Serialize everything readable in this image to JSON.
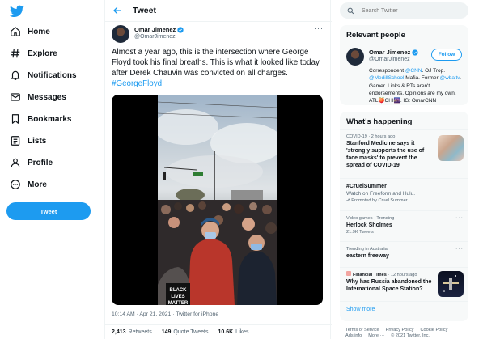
{
  "colors": {
    "accent": "#1d9bf0",
    "text": "#0f1419",
    "muted": "#536471"
  },
  "nav": {
    "logo_icon": "twitter-bird-icon",
    "items": [
      {
        "label": "Home",
        "icon": "home-icon"
      },
      {
        "label": "Explore",
        "icon": "hashtag-icon"
      },
      {
        "label": "Notifications",
        "icon": "bell-icon"
      },
      {
        "label": "Messages",
        "icon": "envelope-icon"
      },
      {
        "label": "Bookmarks",
        "icon": "bookmark-icon"
      },
      {
        "label": "Lists",
        "icon": "list-icon"
      },
      {
        "label": "Profile",
        "icon": "person-icon"
      },
      {
        "label": "More",
        "icon": "more-circle-icon"
      }
    ],
    "tweet_button": "Tweet"
  },
  "header": {
    "title": "Tweet"
  },
  "tweet": {
    "author_name": "Omar Jimenez",
    "author_handle": "@OmarJimenez",
    "text": "Almost a year ago, this is the intersection where George Floyd took his final breaths. This is what it looked like today after Derek Chauvin was convicted on all charges. ",
    "hashtag": "#GeorgeFloyd",
    "timestamp": "10:14 AM · Apr 21, 2021 · Twitter for iPhone",
    "retweets": "2,413",
    "retweets_label": "Retweets",
    "quote_tweets": "149",
    "quote_tweets_label": "Quote Tweets",
    "likes": "10.6K",
    "likes_label": "Likes",
    "media_sign": "BLACK LIVES MATTER"
  },
  "search": {
    "placeholder": "Search Twitter"
  },
  "relevant": {
    "title": "Relevant people",
    "name": "Omar Jimenez",
    "handle": "@OmarJimenez",
    "follow_label": "Follow",
    "bio_1": "Correspondent ",
    "bio_cnn": "@CNN",
    "bio_2": ". OJ Trop. ",
    "bio_medill": "@MedillSchool",
    "bio_3": " Mafia. Former ",
    "bio_wbal": "@wbaltv",
    "bio_4": ". Gamer. Links & RTs aren't endorsements. Opinions are my own. ATL🍑CHI🌆. IG: OmarCNN"
  },
  "happening": {
    "title": "What's happening",
    "trends": [
      {
        "meta": "COVID-19 · 2 hours ago",
        "head": "Stanford Medicine says it 'strongly supports the use of face masks' to prevent the spread of COVID-19"
      },
      {
        "meta": "",
        "head": "#CruelSummer",
        "sub": "Watch on Freeform and Hulu.",
        "promo": "Promoted by Cruel Summer"
      },
      {
        "meta": "Video games · Trending",
        "head": "Herlock Sholmes",
        "sub": "21.9K Tweets"
      },
      {
        "meta": "Trending in Australia",
        "head": "eastern freeway"
      },
      {
        "meta_source": "Financial Times",
        "meta_time": " · 12 hours ago",
        "head": "Why has Russia abandoned the International Space Station?"
      }
    ],
    "show_more": "Show more"
  },
  "footer": [
    "Terms of Service",
    "Privacy Policy",
    "Cookie Policy",
    "Ads info",
    "More ···",
    "© 2021 Twitter, Inc."
  ]
}
